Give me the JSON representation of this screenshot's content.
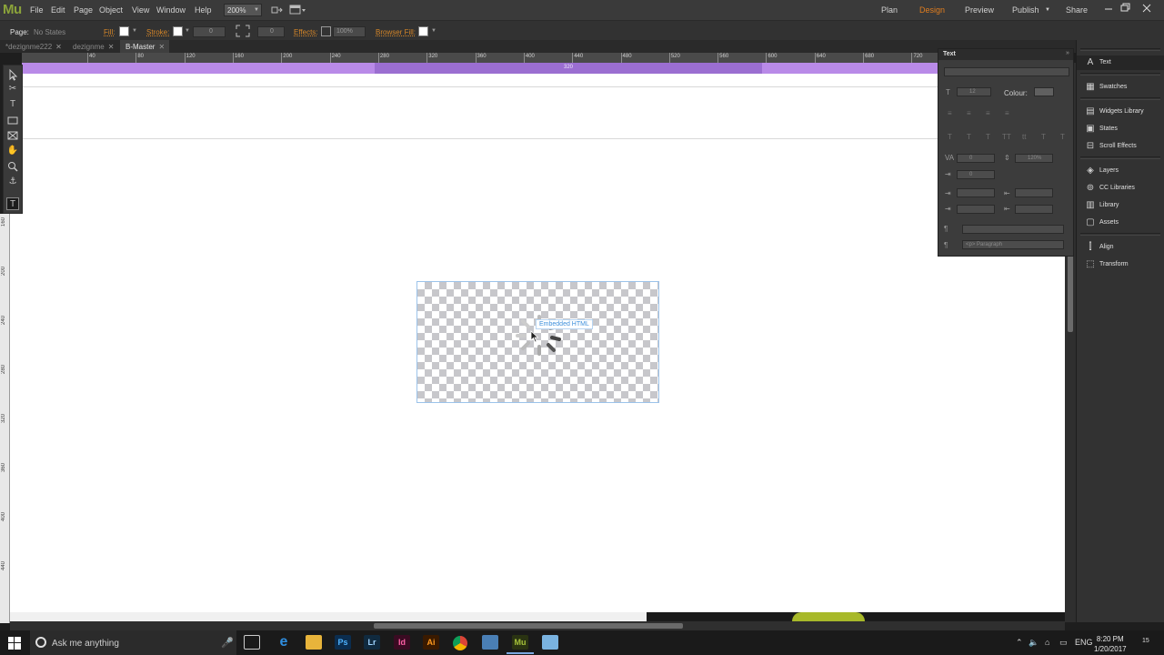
{
  "app": {
    "logo": "Mu"
  },
  "menu": [
    "File",
    "Edit",
    "Page",
    "Object",
    "View",
    "Window",
    "Help"
  ],
  "toolbar": {
    "zoom": "200%"
  },
  "workspace": {
    "plan": "Plan",
    "design": "Design",
    "preview": "Preview",
    "publish": "Publish",
    "share": "Share"
  },
  "options": {
    "page_label": "Page:",
    "page_value": "No States",
    "fill_label": "Fill:",
    "stroke_label": "Stroke:",
    "stroke_value": "0",
    "corner_value": "0",
    "effects_label": "Effects:",
    "opacity": "100%",
    "browser_fill_label": "Browser Fill:"
  },
  "tabs": [
    "*dezignme222",
    "dezignme",
    "B-Master"
  ],
  "ruler": {
    "h_ticks": [
      "40",
      "80",
      "120",
      "160",
      "200",
      "240",
      "280",
      "320",
      "360",
      "400",
      "440",
      "480",
      "520",
      "560",
      "600",
      "640",
      "680",
      "720",
      "760"
    ],
    "width_label": "320",
    "v_ticks": [
      "160",
      "200",
      "240",
      "280",
      "320",
      "360",
      "400",
      "440"
    ]
  },
  "canvas": {
    "embed_label": "Embedded HTML"
  },
  "text_panel": {
    "title": "Text",
    "font_size": "12",
    "colour_label": "Colour:",
    "tracking": "0",
    "leading": "120%",
    "indent": "0",
    "paragraph_style": "<p> Paragraph"
  },
  "dock": [
    {
      "icon": "text-icon",
      "label": "Text"
    },
    {
      "icon": "swatches-icon",
      "label": "Swatches"
    },
    {
      "icon": "widgets-icon",
      "label": "Widgets Library"
    },
    {
      "icon": "states-icon",
      "label": "States"
    },
    {
      "icon": "scroll-effects-icon",
      "label": "Scroll Effects"
    },
    {
      "icon": "layers-icon",
      "label": "Layers"
    },
    {
      "icon": "cc-libraries-icon",
      "label": "CC Libraries"
    },
    {
      "icon": "library-icon",
      "label": "Library"
    },
    {
      "icon": "assets-icon",
      "label": "Assets"
    },
    {
      "icon": "align-icon",
      "label": "Align"
    },
    {
      "icon": "transform-icon",
      "label": "Transform"
    }
  ],
  "taskbar": {
    "search_placeholder": "Ask me anything",
    "lang": "ENG",
    "time": "8:20 PM",
    "date": "1/20/2017",
    "notification_count": "15"
  }
}
